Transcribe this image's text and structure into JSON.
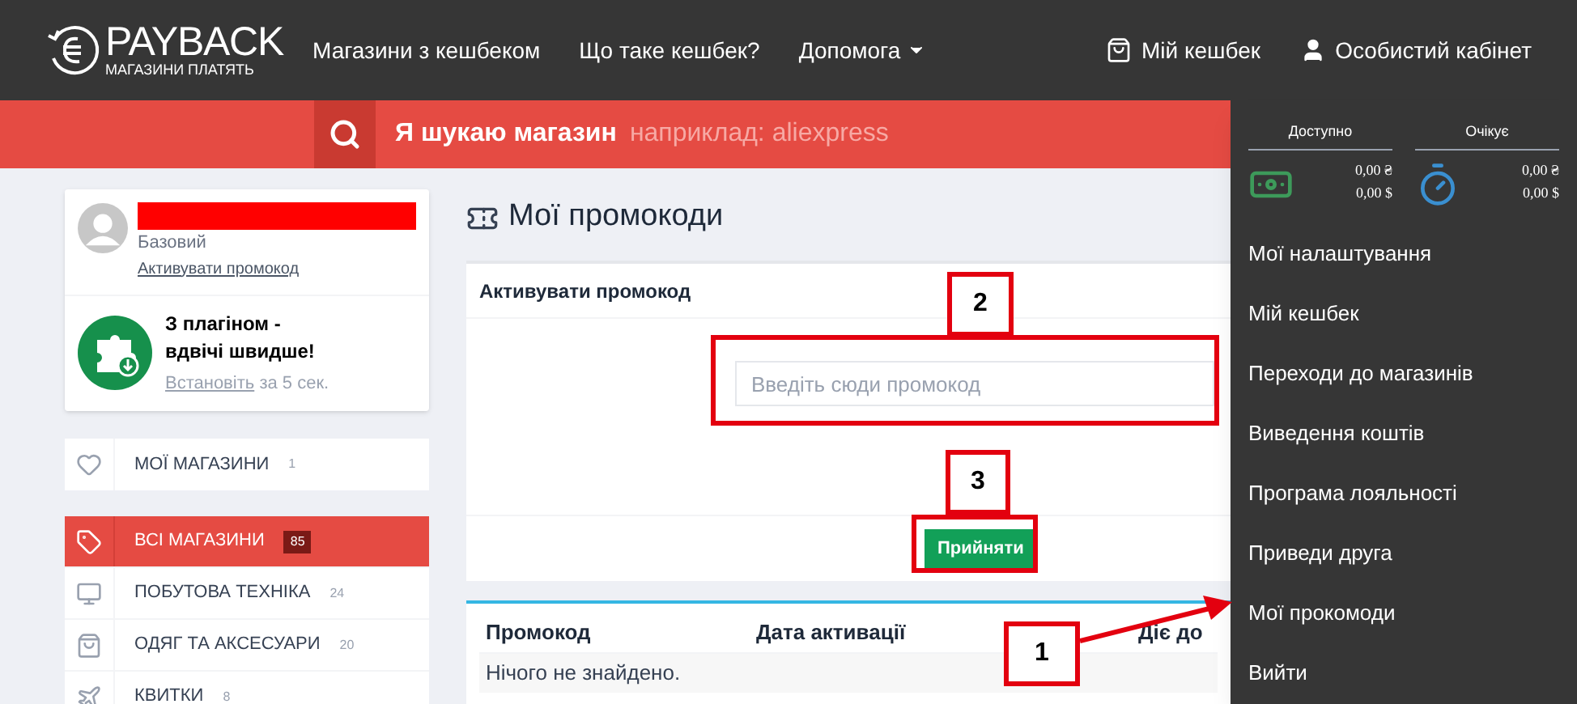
{
  "logo": {
    "name": "PAYBACK",
    "tagline": "МАГАЗИНИ ПЛАТЯТЬ"
  },
  "nav": [
    {
      "label": "Магазини з кешбеком",
      "dropdown": false
    },
    {
      "label": "Що таке кешбек?",
      "dropdown": false
    },
    {
      "label": "Допомога",
      "dropdown": true
    }
  ],
  "nav_right": [
    {
      "label": "Мій кешбек",
      "kind": "bag"
    },
    {
      "label": "Особистий кабінет",
      "kind": "user"
    }
  ],
  "search": {
    "label": "Я шукаю магазин",
    "placeholder": "наприклад: aliexpress"
  },
  "profile": {
    "level": "Базовий",
    "link": "Активувати промокод"
  },
  "plugin": {
    "title": "З плагіном - вдвічі швидше!",
    "link": "Встановіть",
    "suffix": "за 5 сек."
  },
  "favorites": {
    "label": "МОЇ МАГАЗИНИ",
    "count": "1"
  },
  "categories": [
    {
      "label": "ВСІ МАГАЗИНИ",
      "count": "85",
      "selected": true,
      "kind": "tag"
    },
    {
      "label": "ПОБУТОВА ТЕХНІКА",
      "count": "24",
      "selected": false,
      "kind": "monitor"
    },
    {
      "label": "ОДЯГ ТА АКСЕСУАРИ",
      "count": "20",
      "selected": false,
      "kind": "bag"
    },
    {
      "label": "КВИТКИ",
      "count": "8",
      "selected": false,
      "kind": "plane"
    }
  ],
  "page_title": "Мої промокоди",
  "activate_card": {
    "title": "Активувати промокод",
    "placeholder": "Введіть сюди промокод",
    "button": "Прийняти"
  },
  "table": {
    "columns": [
      "Промокод",
      "Дата активації",
      "Діє до"
    ],
    "empty": "Нічого не знайдено."
  },
  "balance": [
    {
      "label": "Доступно",
      "kind": "money",
      "uah": "0,00 ₴",
      "usd": "0,00 $"
    },
    {
      "label": "Очікує",
      "kind": "timer",
      "uah": "0,00 ₴",
      "usd": "0,00 $"
    }
  ],
  "account_menu": [
    "Мої налаштування",
    "Мій кешбек",
    "Переходи до магазинів",
    "Виведення коштів",
    "Програма лояльності",
    "Приведи друга",
    "Мої прокомоди",
    "Вийти"
  ],
  "annotations": [
    "1",
    "2",
    "3"
  ]
}
